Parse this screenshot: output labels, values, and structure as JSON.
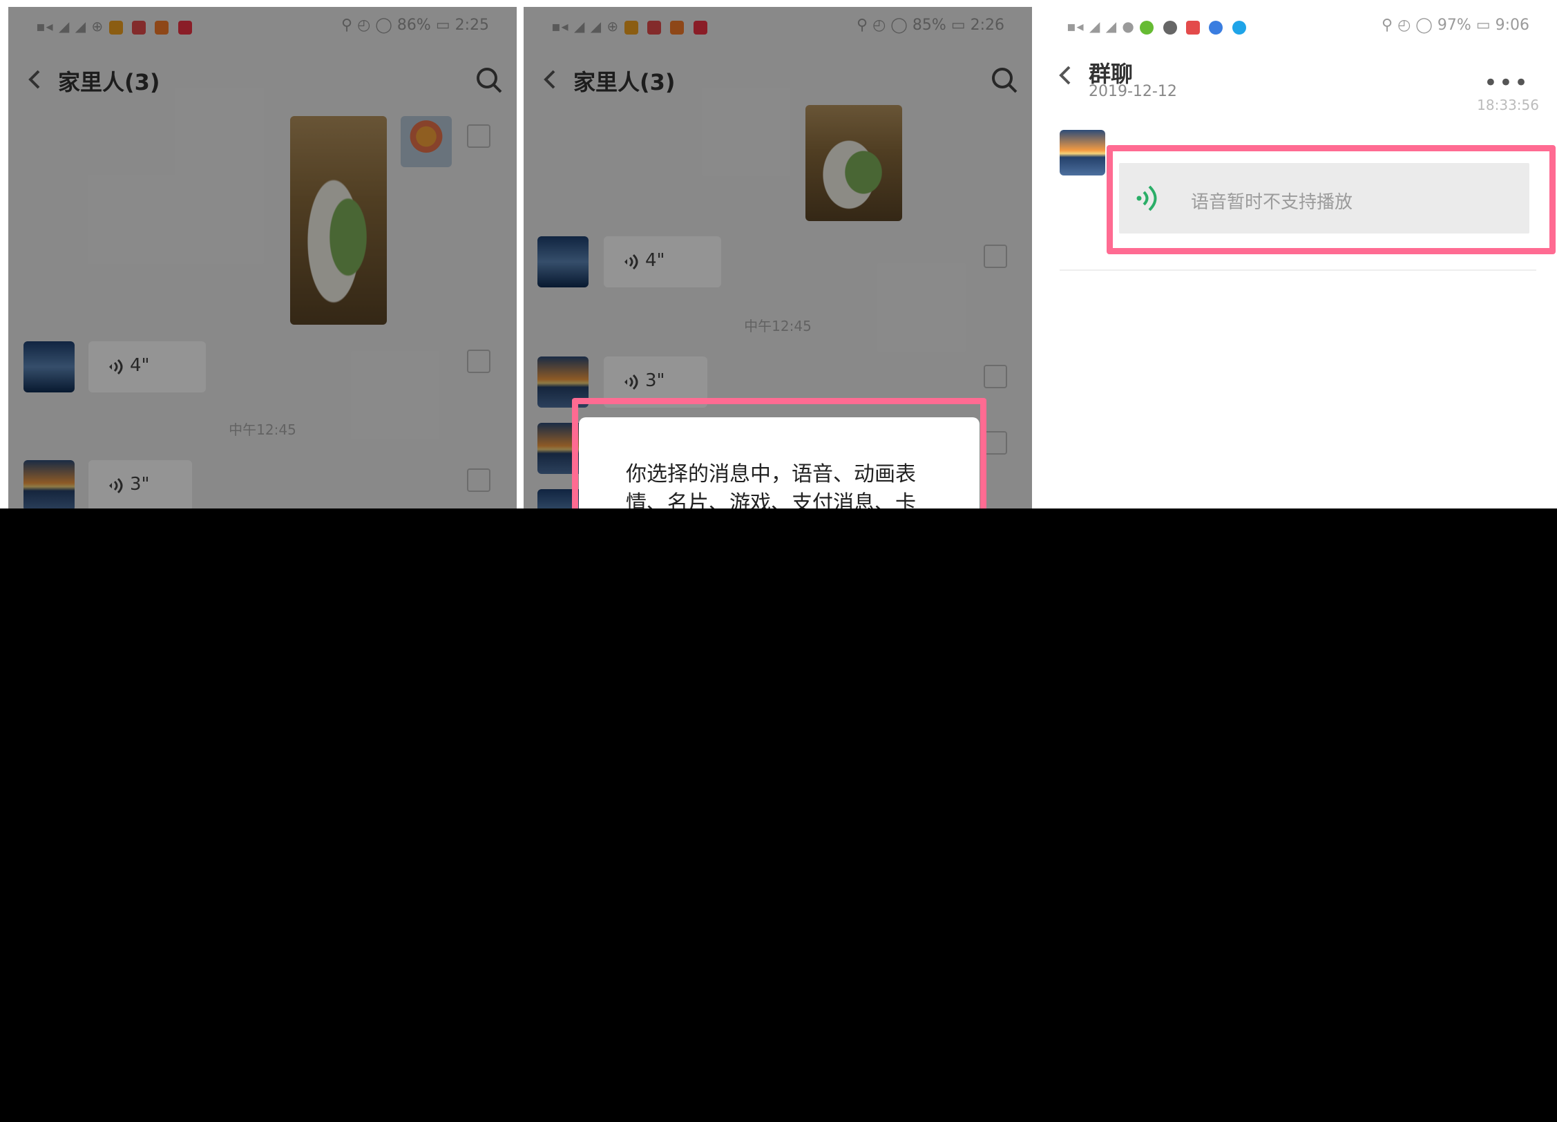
{
  "panel1": {
    "status": {
      "left_text": "▪︎◂ ◢ ◢ ⊕",
      "right_text": "⚲ ◴ ◯ 86% ▭ 2:25"
    },
    "title": "家里人(3)",
    "messages": [
      {
        "type": "voice",
        "duration": "4\""
      },
      {
        "type": "timestamp",
        "text": "中午12:45"
      },
      {
        "type": "voice",
        "duration": "3\""
      }
    ]
  },
  "panel2": {
    "status": {
      "left_text": "▪︎◂ ◢ ◢ ⊕",
      "right_text": "⚲ ◴ ◯ 85% ▭ 2:26"
    },
    "title": "家里人(3)",
    "messages": [
      {
        "type": "voice",
        "duration": "4\""
      },
      {
        "type": "timestamp",
        "text": "中午12:45"
      },
      {
        "type": "voice",
        "duration": "3\""
      }
    ],
    "dialog": {
      "text": "你选择的消息中，语音、动画表情、名片、游戏、支付消息、卡"
    }
  },
  "panel3": {
    "status": {
      "left_text": "▪︎◂ ◢ ◢ ●",
      "right_text": "⚲ ◴ ◯ 97% ▭ 9:06"
    },
    "title": "群聊",
    "date": "2019-12-12",
    "time": "18:33:56",
    "voice_msg": "语音暂时不支持播放"
  },
  "colors": {
    "highlight": "#ff6b92",
    "voice_green": "#2aae67"
  }
}
